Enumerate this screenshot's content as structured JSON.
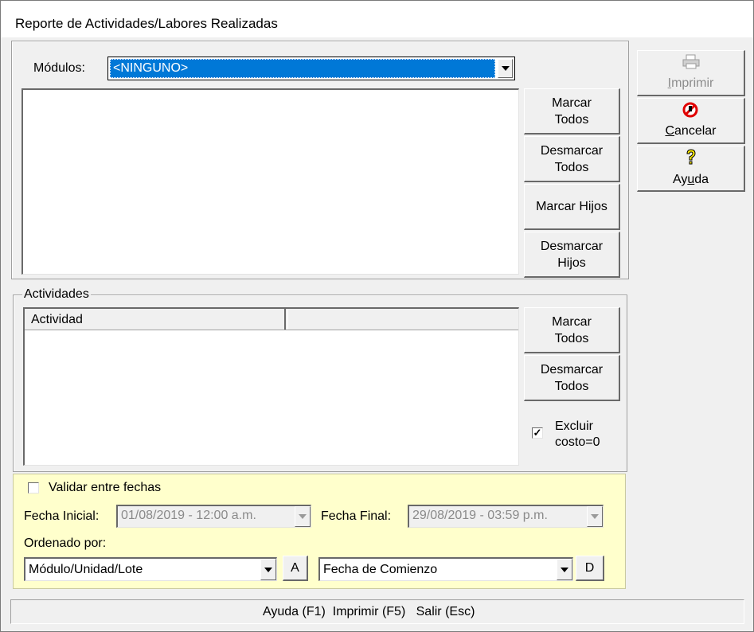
{
  "window": {
    "title": "Reporte de Actividades/Labores Realizadas"
  },
  "modulos": {
    "label": "Módulos:",
    "selected": "<NINGUNO>",
    "buttons": {
      "marcar_todos": [
        "Marcar",
        "Todos"
      ],
      "desmarcar_todos": [
        "Desmarcar",
        "Todos"
      ],
      "marcar_hijos": "Marcar Hijos",
      "desmarcar_hijos": [
        "Desmarcar",
        "Hijos"
      ]
    }
  },
  "actividades": {
    "group_label": "Actividades",
    "columns": [
      "Actividad",
      ""
    ],
    "buttons": {
      "marcar_todos": [
        "Marcar",
        "Todos"
      ],
      "desmarcar_todos": [
        "Desmarcar",
        "Todos"
      ]
    },
    "excluir": {
      "label": [
        "Excluir",
        "costo=0"
      ],
      "checked": true
    }
  },
  "filters": {
    "validar_label": "Validar entre fechas",
    "validar_checked": false,
    "fecha_inicial_label": "Fecha Inicial:",
    "fecha_inicial_value": "01/08/2019 - 12:00 a.m.",
    "fecha_final_label": "Fecha Final:",
    "fecha_final_value": "29/08/2019 - 03:59 p.m.",
    "ordenado_label": "Ordenado por:",
    "orden1_value": "Módulo/Unidad/Lote",
    "orden1_dir": "A",
    "orden2_value": "Fecha de Comienzo",
    "orden2_dir": "D",
    "bg": "#ffffcc"
  },
  "side_buttons": {
    "imprimir": {
      "prefix": "",
      "accel": "I",
      "rest": "mprimir",
      "enabled": false
    },
    "cancelar": {
      "prefix": "",
      "accel": "C",
      "rest": "ancelar",
      "enabled": true
    },
    "ayuda": {
      "prefix": "Ay",
      "accel": "u",
      "rest": "da",
      "enabled": true
    }
  },
  "statusbar": {
    "text": "Ayuda (F1)  Imprimir (F5)   Salir (Esc)"
  },
  "colors": {
    "selection": "#0078d7",
    "dialog_bg": "#f0f0f0"
  }
}
